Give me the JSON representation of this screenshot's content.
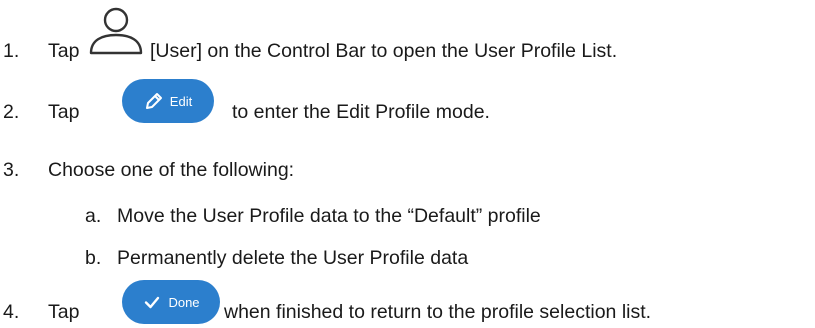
{
  "steps": [
    {
      "number": "1.",
      "pre": "Tap",
      "label": "[User] on the Control Bar to open the User Profile List."
    },
    {
      "number": "2.",
      "pre": "Tap",
      "label": "to enter the Edit Profile mode."
    },
    {
      "number": "3.",
      "label": "Choose one of the following:"
    },
    {
      "number": "4.",
      "pre": "Tap",
      "label": "when finished to return to the profile selection list."
    }
  ],
  "options": [
    {
      "letter": "a.",
      "text": "Move the User Profile data to the “Default” profile"
    },
    {
      "letter": "b.",
      "text": "Permanently delete the User Profile data"
    }
  ],
  "buttons": {
    "edit_label": "Edit",
    "done_label": "Done"
  },
  "icons": {
    "user": "user-icon",
    "edit": "pencil-icon",
    "done": "checkmark-icon"
  },
  "colors": {
    "button_bg": "#2c7fcd",
    "button_fg": "#ffffff",
    "text": "#1a1a1a"
  }
}
